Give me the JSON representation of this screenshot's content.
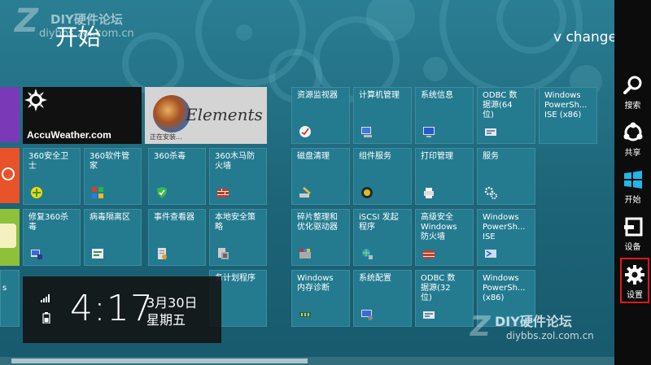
{
  "screen": {
    "title": "开始",
    "user": "v change"
  },
  "watermarks": {
    "top": {
      "line1": "DIY硬件论坛",
      "line2": "diybbs.zol.com.cn"
    },
    "bottom": {
      "line1": "DIY硬件论坛",
      "line2": "diybbs.zol.com.cn"
    }
  },
  "apps": {
    "accuweather": {
      "label": "AccuWeather.com"
    },
    "elements": {
      "logo_text": "Elements",
      "status": "正在安装..."
    }
  },
  "tiles": [
    {
      "label": "360安全卫\n士",
      "icon": "360-safe-icon"
    },
    {
      "label": "360软件管\n家",
      "icon": "360-software-icon"
    },
    {
      "label": "360杀毒",
      "icon": "360-antivirus-icon"
    },
    {
      "label": "360木马防\n火墙",
      "icon": "360-firewall-icon"
    },
    {
      "label": "修复360杀\n毒",
      "icon": "repair-icon"
    },
    {
      "label": "病毒隔离区",
      "icon": "quarantine-icon"
    },
    {
      "label": "事件查看器",
      "icon": "event-viewer-icon"
    },
    {
      "label": "本地安全策\n略",
      "icon": "security-policy-icon"
    },
    {
      "label": "资源监视器",
      "icon": "resource-monitor-icon"
    },
    {
      "label": "计算机管理",
      "icon": "computer-management-icon"
    },
    {
      "label": "系统信息",
      "icon": "system-info-icon"
    },
    {
      "label": "ODBC 数\n据源(64\n位)",
      "icon": "odbc-icon"
    },
    {
      "label": "Windows\nPowerSh...\nISE (x86)",
      "icon": "powershell-ise-icon"
    },
    {
      "label": "磁盘清理",
      "icon": "disk-cleanup-icon"
    },
    {
      "label": "组件服务",
      "icon": "component-services-icon"
    },
    {
      "label": "打印管理",
      "icon": "print-management-icon"
    },
    {
      "label": "服务",
      "icon": "services-icon"
    },
    {
      "label": "碎片整理和\n优化驱动器",
      "icon": "defrag-icon"
    },
    {
      "label": "iSCSI 发起\n程序",
      "icon": "iscsi-icon"
    },
    {
      "label": "高级安全\nWindows\n防火墙",
      "icon": "firewall-icon"
    },
    {
      "label": "Windows\nPowerSh...\nISE",
      "icon": "powershell-ise-icon"
    },
    {
      "label": "Windows\n内存诊断",
      "icon": "memory-diagnostic-icon"
    },
    {
      "label": "系统配置",
      "icon": "system-config-icon"
    },
    {
      "label": "ODBC 数\n据源(32\n位)",
      "icon": "odbc-icon"
    },
    {
      "label": "Windows\nPowerSh...\n(x86)",
      "icon": "powershell-icon"
    },
    {
      "label": "务计划程序",
      "icon": "task-scheduler-icon"
    },
    {
      "label": "s",
      "icon": ""
    }
  ],
  "clock": {
    "time": "4:17",
    "date": "3月30日",
    "weekday": "星期五"
  },
  "charms": [
    {
      "label": "搜索",
      "icon": "search-icon"
    },
    {
      "label": "共享",
      "icon": "share-icon"
    },
    {
      "label": "开始",
      "icon": "windows-logo-icon"
    },
    {
      "label": "设备",
      "icon": "devices-icon"
    },
    {
      "label": "设置",
      "icon": "gear-icon",
      "selected": true
    }
  ],
  "colors": {
    "background": "#1e6a7f",
    "tile": "#247b90",
    "charms_bar": "#0c0c0c",
    "selection": "#e01818"
  }
}
